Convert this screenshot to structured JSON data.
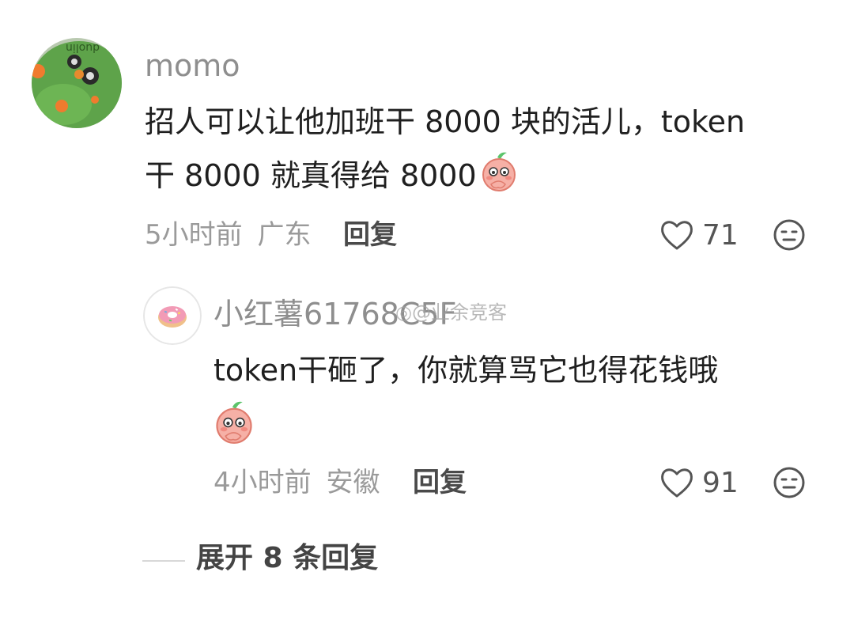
{
  "comment": {
    "username": "momo",
    "line1": "招人可以让他加班干 8000 块的活儿，token",
    "line2": "干 8000 就真得给 8000",
    "time": "5小时前",
    "location": "广东",
    "reply_label": "回复",
    "like_count": "71",
    "avatar_watermark": "duolin",
    "sticker_icon": "blushing-peach-sticker",
    "like_icon": "heart-outline-icon",
    "dislike_icon": "neutral-face-icon"
  },
  "reply": {
    "username": "小红薯61768C5F",
    "line1": "token干砸了，你就算骂它也得花钱哦",
    "time": "4小时前",
    "location": "安徽",
    "reply_label": "回复",
    "like_count": "91",
    "sticker_icon": "blushing-peach-sticker",
    "like_icon": "heart-outline-icon",
    "dislike_icon": "neutral-face-icon"
  },
  "expand_label": "展开 8 条回复",
  "watermark": "@业余竞客",
  "colors": {
    "text_primary": "#1f1f1f",
    "text_secondary": "#8e8e8e",
    "sticker_pink": "#f5a6a0",
    "avatar_green": "#5fa84a"
  }
}
